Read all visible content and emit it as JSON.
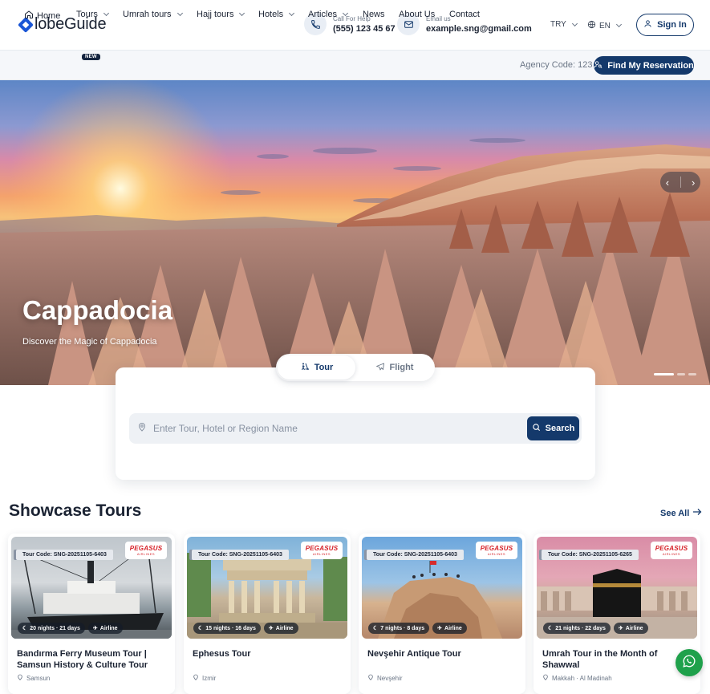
{
  "brand": {
    "logo_text": "lobeGuide",
    "accent": "#14396b"
  },
  "contacts": {
    "phone_label": "Call For Help",
    "phone_value": "(555) 123 45 67",
    "email_label": "Email us",
    "email_value": "example.sng@gmail.com"
  },
  "header": {
    "currency": "TRY",
    "language": "EN",
    "signin_label": "Sign In"
  },
  "nav": {
    "items": [
      {
        "label": "Home",
        "icon": "home-icon"
      },
      {
        "label": "Tours",
        "badge": "NEW"
      },
      {
        "label": "Umrah tours"
      },
      {
        "label": "Hajj tours"
      },
      {
        "label": "Hotels"
      },
      {
        "label": "Articles"
      },
      {
        "label": "News"
      },
      {
        "label": "About Us"
      },
      {
        "label": "Contact"
      }
    ],
    "agency_code": "Agency Code: 123",
    "find_reservation": "Find My Reservation"
  },
  "hero": {
    "title": "Cappadocia",
    "subtitle": "Discover the Magic of Cappadocia",
    "slides": 3,
    "active_slide": 0
  },
  "search": {
    "tabs": [
      {
        "label": "Tour",
        "icon": "tour-icon"
      },
      {
        "label": "Flight",
        "icon": "plane-icon"
      }
    ],
    "active_tab": 0,
    "placeholder": "Enter Tour, Hotel or Region Name",
    "button_label": "Search"
  },
  "showcase": {
    "title": "Showcase Tours",
    "see_all": "See All",
    "cards": [
      {
        "code": "Tour Code: SNG-20251105-6403",
        "airline": "PEGASUS",
        "airline_sub": "AIRLINES",
        "duration": "20 nights · 21 days",
        "transport": "Airline",
        "title": "Bandırma Ferry Museum Tour | Samsun History & Culture Tour",
        "location": "Samsun"
      },
      {
        "code": "Tour Code: SNG-20251105-6403",
        "airline": "PEGASUS",
        "airline_sub": "AIRLINES",
        "duration": "15 nights · 16 days",
        "transport": "Airline",
        "title": "Ephesus Tour",
        "location": "Izmir"
      },
      {
        "code": "Tour Code: SNG-20251105-6403",
        "airline": "PEGASUS",
        "airline_sub": "AIRLINES",
        "duration": "7 nights · 8 days",
        "transport": "Airline",
        "title": "Nevşehir Antique Tour",
        "location": "Nevşehir"
      },
      {
        "code": "Tour Code: SNG-20251105-6265",
        "airline": "PEGASUS",
        "airline_sub": "AIRLINES",
        "duration": "21 nights · 22 days",
        "transport": "Airline",
        "title": "Umrah Tour in the Month of Shawwal",
        "location": "Makkah · Al Madinah"
      }
    ]
  }
}
